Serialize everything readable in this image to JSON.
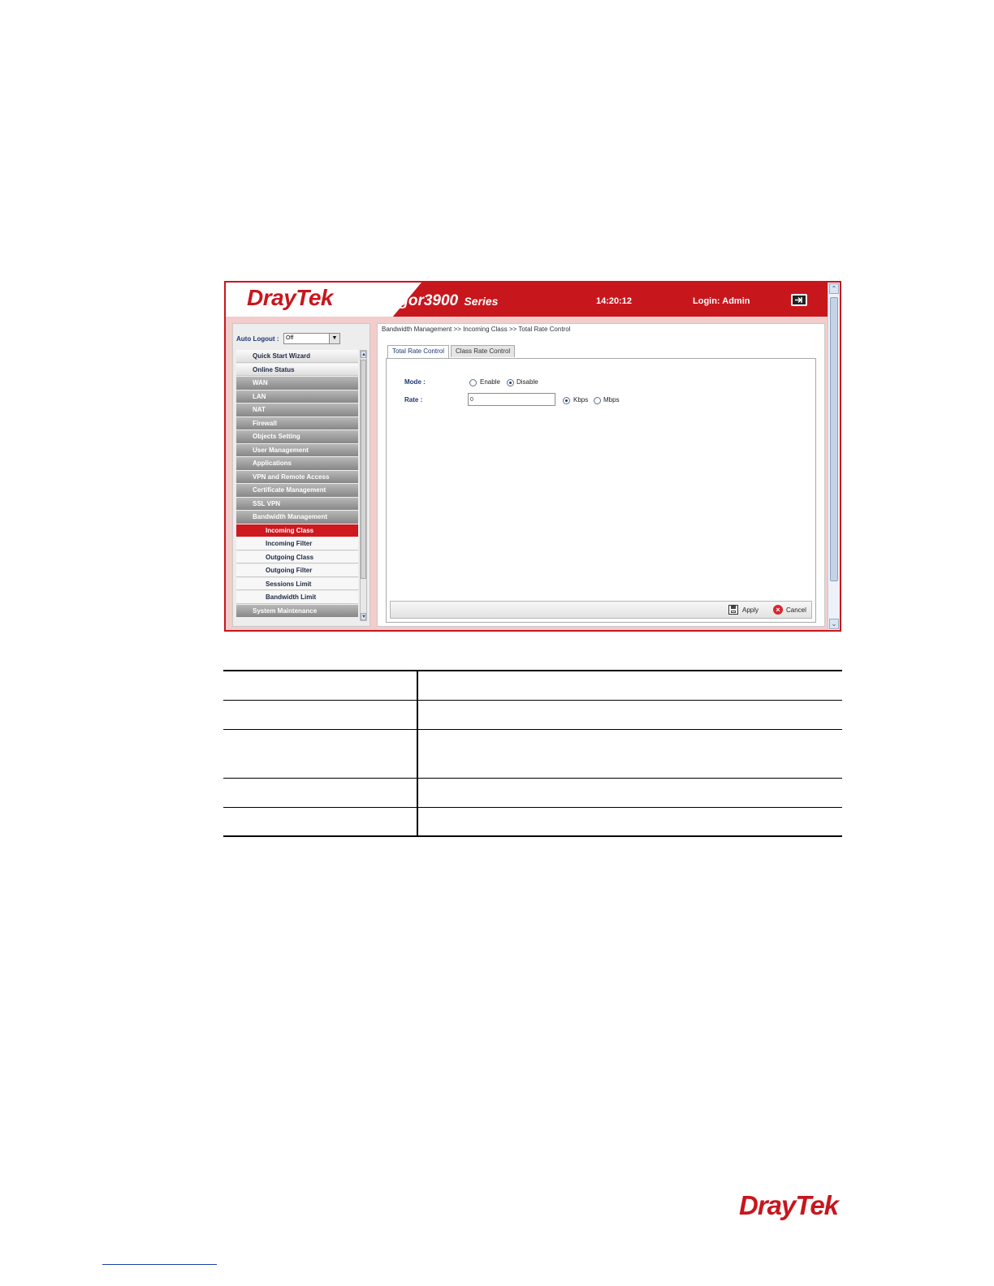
{
  "header": {
    "brand": "DrayTek",
    "model": "Vigor3900",
    "series": "Series",
    "time": "14:20:12",
    "login": "Login: Admin"
  },
  "sidebar": {
    "auto_logout_label": "Auto Logout :",
    "auto_logout_value": "Off",
    "items": [
      {
        "label": "Quick Start Wizard",
        "type": "plain"
      },
      {
        "label": "Online Status",
        "type": "plain"
      },
      {
        "label": "WAN",
        "type": "group"
      },
      {
        "label": "LAN",
        "type": "group"
      },
      {
        "label": "NAT",
        "type": "group"
      },
      {
        "label": "Firewall",
        "type": "group"
      },
      {
        "label": "Objects Setting",
        "type": "group"
      },
      {
        "label": "User Management",
        "type": "group"
      },
      {
        "label": "Applications",
        "type": "group"
      },
      {
        "label": "VPN and Remote Access",
        "type": "group"
      },
      {
        "label": "Certificate Management",
        "type": "group"
      },
      {
        "label": "SSL VPN",
        "type": "group"
      },
      {
        "label": "Bandwidth Management",
        "type": "group"
      },
      {
        "label": "Incoming Class",
        "type": "active"
      },
      {
        "label": "Incoming Filter",
        "type": "sub"
      },
      {
        "label": "Outgoing Class",
        "type": "sub"
      },
      {
        "label": "Outgoing Filter",
        "type": "sub"
      },
      {
        "label": "Sessions Limit",
        "type": "sub"
      },
      {
        "label": "Bandwidth Limit",
        "type": "sub"
      },
      {
        "label": "System Maintenance",
        "type": "group"
      }
    ]
  },
  "main": {
    "breadcrumb": "Bandwidth Management >> Incoming Class >> Total Rate Control",
    "tabs": [
      "Total Rate Control",
      "Class Rate Control"
    ],
    "mode_label": "Mode :",
    "mode_enable": "Enable",
    "mode_disable": "Disable",
    "mode_selected": "Disable",
    "rate_label": "Rate :",
    "rate_value": "0",
    "unit_kbps": "Kbps",
    "unit_mbps": "Mbps",
    "unit_selected": "Kbps",
    "apply_label": "Apply",
    "cancel_label": "Cancel"
  },
  "footer": {
    "brand": "DrayTek"
  },
  "colors": {
    "accent": "#c8161d",
    "label_blue": "#1d3770"
  }
}
